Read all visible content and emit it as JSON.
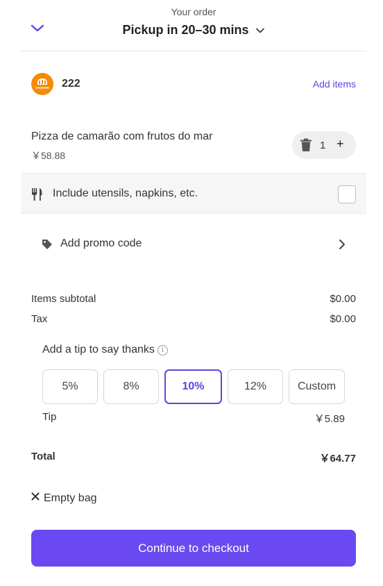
{
  "header": {
    "subtitle": "Your order",
    "title": "Pickup in 20–30 mins"
  },
  "store": {
    "name": "222",
    "add_items_label": "Add items",
    "logo_icon": "store-logo-icon",
    "logo_text": "DASHER"
  },
  "item": {
    "name": "Pizza de camarão com frutos do mar",
    "price": "￥58.88",
    "quantity": "1",
    "plus_label": "+"
  },
  "utensils": {
    "label": "Include utensils, napkins, etc.",
    "checked": false
  },
  "promo": {
    "label": "Add promo code"
  },
  "summary": {
    "subtotal_label": "Items subtotal",
    "subtotal_value": "$0.00",
    "tax_label": "Tax",
    "tax_value": "$0.00"
  },
  "tip": {
    "title": "Add a tip to say thanks",
    "info_glyph": "i",
    "options": [
      "5%",
      "8%",
      "10%",
      "12%",
      "Custom"
    ],
    "selected": "10%",
    "label": "Tip",
    "value": "￥5.89"
  },
  "total": {
    "label": "Total",
    "value": "￥64.77"
  },
  "empty_bag_label": "Empty bag",
  "checkout_label": "Continue to checkout",
  "colors": {
    "accent": "#5c45e0",
    "button": "#6a4af0",
    "logo": "#f58a07"
  }
}
